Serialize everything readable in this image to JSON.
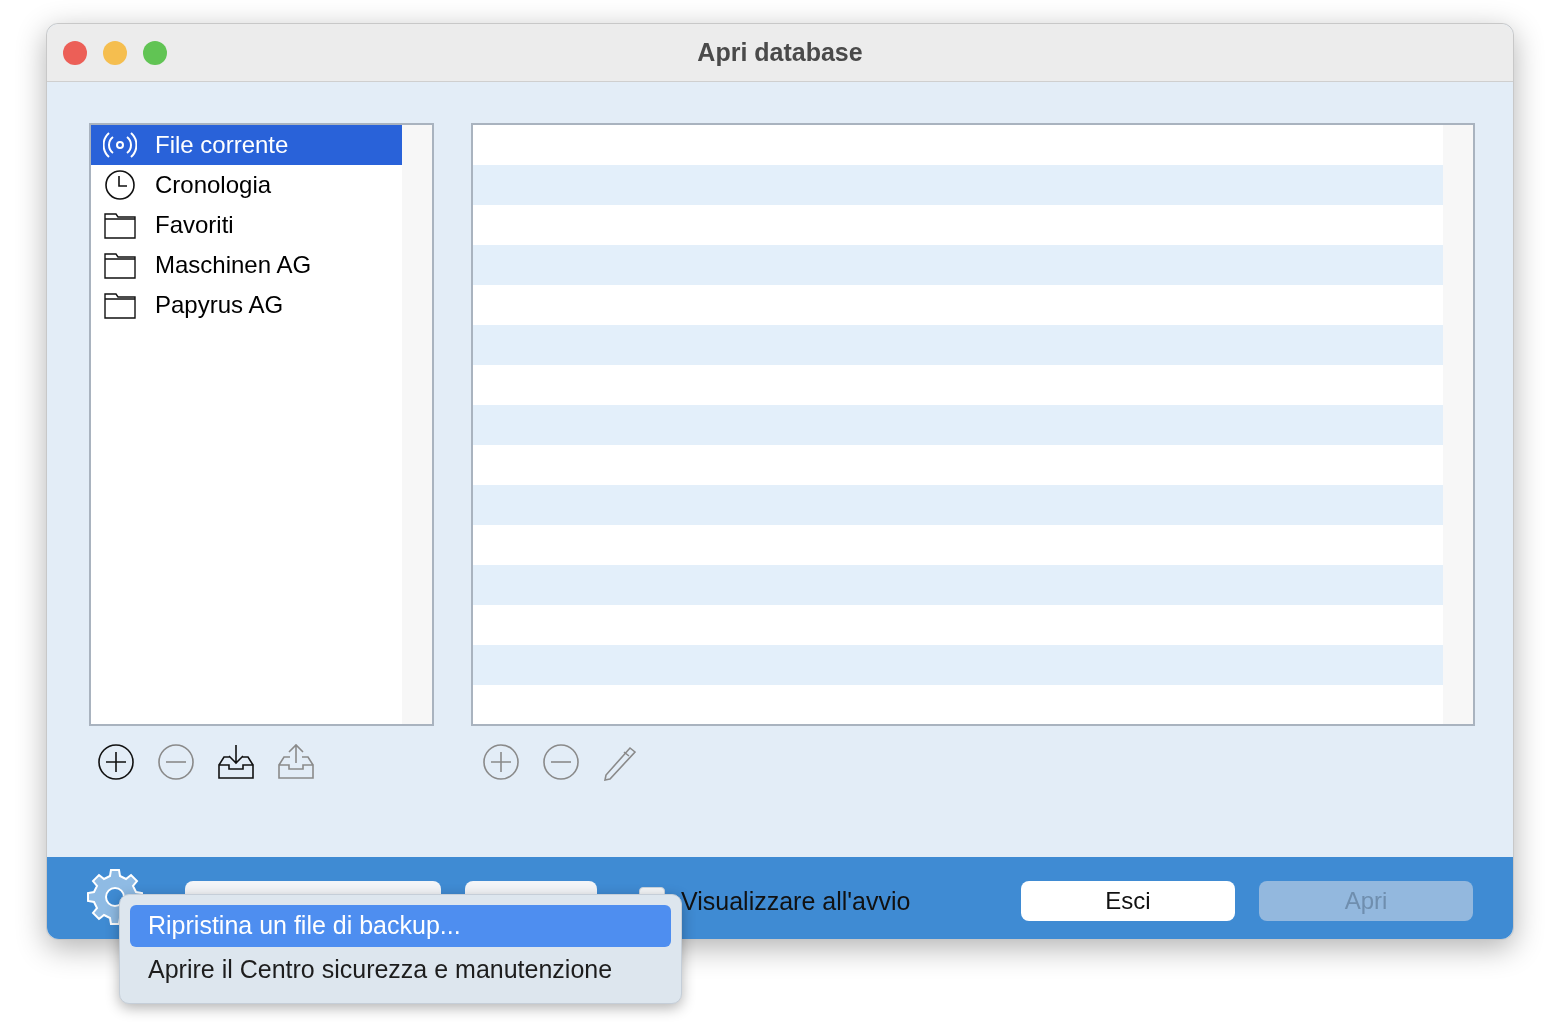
{
  "window": {
    "title": "Apri database"
  },
  "sidebar": {
    "items": [
      {
        "label": "File corrente",
        "kind": "broadcast",
        "selected": true
      },
      {
        "label": "Cronologia",
        "kind": "clock",
        "selected": false
      },
      {
        "label": "Favoriti",
        "kind": "folder",
        "selected": false
      },
      {
        "label": "Maschinen AG",
        "kind": "folder",
        "selected": false
      },
      {
        "label": "Papyrus AG",
        "kind": "folder",
        "selected": false
      }
    ]
  },
  "sidebar_tools": [
    {
      "kind": "add",
      "disabled": false
    },
    {
      "kind": "remove",
      "disabled": true
    },
    {
      "kind": "import",
      "disabled": false
    },
    {
      "kind": "export",
      "disabled": true
    }
  ],
  "table_tools": [
    {
      "kind": "add",
      "disabled": true
    },
    {
      "kind": "remove",
      "disabled": true
    },
    {
      "kind": "edit",
      "disabled": true
    }
  ],
  "footer": {
    "checkbox": {
      "label": "Visualizzare all'avvio",
      "checked": false
    },
    "buttons": [
      {
        "label": "Esci",
        "disabled": false
      },
      {
        "label": "Apri",
        "disabled": true
      }
    ]
  },
  "menu": {
    "items": [
      {
        "label": "Ripristina un file di backup...",
        "selected": true
      },
      {
        "label": "Aprire il Centro sicurezza e manutenzione",
        "selected": false
      }
    ]
  }
}
